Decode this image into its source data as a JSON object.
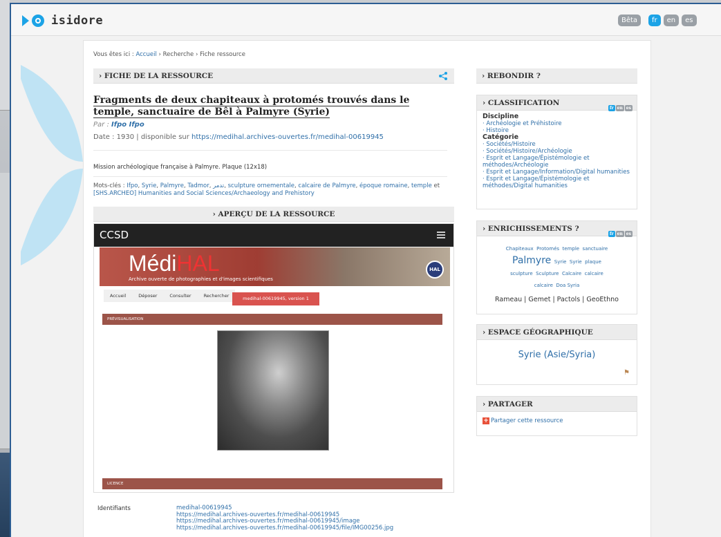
{
  "app": {
    "logo_text": "isidore",
    "beta": "Bêta",
    "langs": [
      "fr",
      "en",
      "es"
    ]
  },
  "breadcrumb": {
    "prefix": "Vous êtes ici :",
    "home": "Accueil",
    "sep": "›",
    "search": "Recherche",
    "current": "Fiche ressource"
  },
  "fiche": {
    "section_title": "› FICHE DE LA RESSOURCE"
  },
  "resource": {
    "title": "Fragments de deux chapiteaux à protomés trouvés dans le temple, sanctuaire de Bêl à Palmyre (Syrie)",
    "par_label": "Par :",
    "author": "Ifpo Ifpo",
    "date_label": "Date : 1930",
    "dispo_label": "| disponible sur",
    "url": "https://medihal.archives-ouvertes.fr/medihal-00619945",
    "description": "Mission archéologique française à Palmyre. Plaque (12x18)",
    "keywords_label": "Mots-clés :",
    "keywords": [
      "Ifpo",
      "Syrie",
      "Palmyre",
      "Tadmor",
      "تدمر",
      "sculpture ornementale",
      "calcaire de Palmyre",
      "époque romaine",
      "temple",
      "[SHS.ARCHEO] Humanities and Social Sciences/Archaeology and Prehistory"
    ]
  },
  "apercu": {
    "section_title": "› APERÇU DE LA RESSOURCE",
    "ccsd": "CCSD",
    "brand_medi": "Médi",
    "brand_hal": "HAL",
    "brand_sub": "Archive ouverte de photographies et d'images scientifiques",
    "hal_badge": "HAL",
    "nav": [
      "Accueil",
      "Déposer",
      "Consulter",
      "Rechercher"
    ],
    "version_btn": "medihal-00619945, version 1",
    "previsualisation": "PRÉVISUALISATION",
    "licence": "LICENCE"
  },
  "identifiants": {
    "label": "Identifiants",
    "values": [
      "medihal-00619945",
      "https://medihal.archives-ouvertes.fr/medihal-00619945",
      "https://medihal.archives-ouvertes.fr/medihal-00619945/image",
      "https://medihal.archives-ouvertes.fr/medihal-00619945/file/IMG00256.jpg"
    ]
  },
  "sidebar": {
    "rebondir": "› REBONDIR ?",
    "classification": {
      "title": "› CLASSIFICATION",
      "flags": [
        "fr",
        "en",
        "es"
      ],
      "discipline_label": "Discipline",
      "discipline": [
        "· Archéologie et Préhistoire",
        "· Histoire"
      ],
      "categorie_label": "Catégorie",
      "categorie": [
        "· Sociétés/Histoire",
        "· Sociétés/Histoire/Archéologie",
        "· Esprit et Langage/Épistémologie et méthodes/Archéologie",
        "· Esprit et Langage/Information/Digital humanities",
        "· Esprit et Langage/Épistémologie et méthodes/Digital humanities"
      ]
    },
    "enrich": {
      "title": "› ENRICHISSEMENTS ?",
      "flags": [
        "fr",
        "en",
        "es"
      ],
      "tags": [
        "Chapiteaux",
        "Protomés",
        "temple",
        "sanctuaire",
        "Palmyre",
        "Syrie",
        "Syrie",
        "plaque",
        "sculpture",
        "Sculpture",
        "Calcaire",
        "calcaire",
        "calcaire",
        "Doa Syria"
      ],
      "links": "Rameau | Gemet | Pactols | GeoEthno"
    },
    "geo": {
      "title": "› ESPACE GÉOGRAPHIQUE",
      "value": "Syrie (Asie/Syria)"
    },
    "share": {
      "title": "› PARTAGER",
      "link": "Partager cette ressource"
    }
  },
  "colors": {
    "accent": "#1ca3e6",
    "link": "#2f6fa8",
    "medihal_red": "#9c5449"
  }
}
